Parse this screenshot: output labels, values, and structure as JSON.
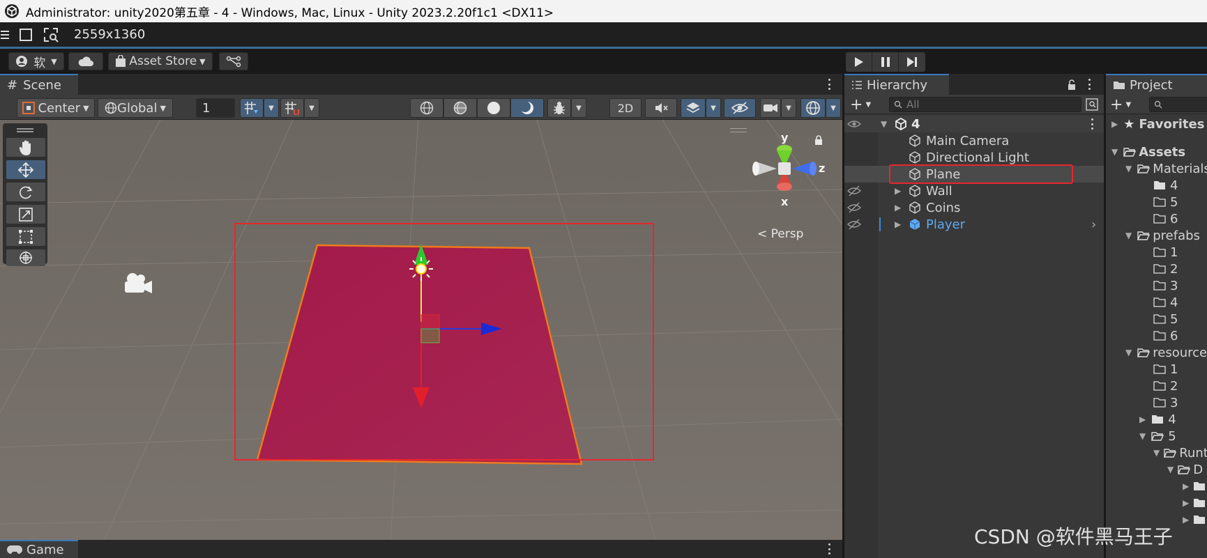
{
  "window": {
    "title": "Administrator: unity2020第五章 - 4 - Windows, Mac, Linux - Unity 2023.2.20f1c1 <DX11>",
    "resolution": "2559x1360"
  },
  "main_toolbar": {
    "account_label": "软",
    "asset_store_label": "Asset Store"
  },
  "scene": {
    "tab_label": "Scene",
    "pivot_label": "Center",
    "space_label": "Global",
    "grid_value": "1",
    "mode_2d": "2D",
    "persp_label": "< Persp",
    "axis_labels": {
      "x": "x",
      "y": "y",
      "z": "z"
    }
  },
  "hierarchy": {
    "tab_label": "Hierarchy",
    "search_placeholder": "All",
    "scene_name": "4",
    "items": [
      {
        "label": "Main Camera",
        "selected": false
      },
      {
        "label": "Directional Light",
        "selected": false
      },
      {
        "label": "Plane",
        "selected": true
      },
      {
        "label": "Wall",
        "selected": false
      },
      {
        "label": "Coins",
        "selected": false
      },
      {
        "label": "Player",
        "selected": false
      }
    ]
  },
  "project": {
    "tab_label": "Project",
    "favorites_label": "Favorites",
    "assets_label": "Assets",
    "tree": [
      {
        "label": "Materials"
      },
      {
        "label": "4"
      },
      {
        "label": "5"
      },
      {
        "label": "6"
      },
      {
        "label": "prefabs"
      },
      {
        "label": "1"
      },
      {
        "label": "2"
      },
      {
        "label": "3"
      },
      {
        "label": "4"
      },
      {
        "label": "5"
      },
      {
        "label": "6"
      },
      {
        "label": "resources"
      },
      {
        "label": "1"
      },
      {
        "label": "2"
      },
      {
        "label": "3"
      },
      {
        "label": "4"
      },
      {
        "label": "5"
      },
      {
        "label": "Runtime"
      },
      {
        "label": "D"
      }
    ]
  },
  "game": {
    "tab_label": "Game"
  },
  "watermark": "CSDN @软件黑马王子",
  "colors": {
    "selection_box": "#e8262c",
    "plane_fill": "#a31a4a",
    "plane_outline": "#f07a1a",
    "tab_accent": "#3a79bb",
    "player_prefab": "#5fa8f2"
  }
}
